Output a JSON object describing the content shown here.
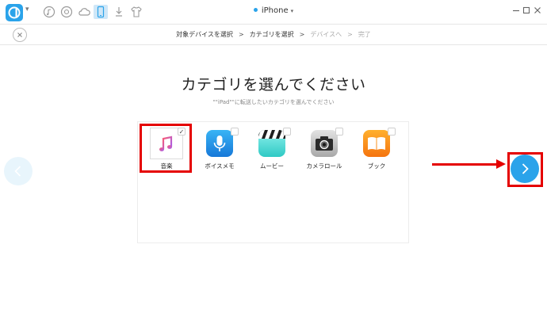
{
  "titlebar": {
    "device_name": "iPhone",
    "tool_icons": [
      "music-icon",
      "video-icon",
      "cloud-icon",
      "phone-icon",
      "download-icon",
      "tshirt-icon"
    ],
    "active_tool": "phone-icon"
  },
  "steps": {
    "items": [
      {
        "label": "対象デバイスを選択",
        "state": "done"
      },
      {
        "label": "カテゴリを選択",
        "state": "current"
      },
      {
        "label": "デバイスへ",
        "state": "pending"
      },
      {
        "label": "完了",
        "state": "pending"
      }
    ],
    "separator": ">"
  },
  "main": {
    "heading": "カテゴリを選んでください",
    "subheading": "\"\"iPad\"\"に転送したいカテゴリを選んでください"
  },
  "categories": [
    {
      "label": "音楽",
      "icon": "music-note-icon",
      "checked": true
    },
    {
      "label": "ボイスメモ",
      "icon": "microphone-icon",
      "checked": false
    },
    {
      "label": "ムービー",
      "icon": "clapperboard-icon",
      "checked": false
    },
    {
      "label": "カメラロール",
      "icon": "camera-icon",
      "checked": false
    },
    {
      "label": "ブック",
      "icon": "book-icon",
      "checked": false
    }
  ],
  "checkmark": "✓",
  "colors": {
    "accent": "#2aa3ea",
    "annotation_red": "#e50000"
  }
}
